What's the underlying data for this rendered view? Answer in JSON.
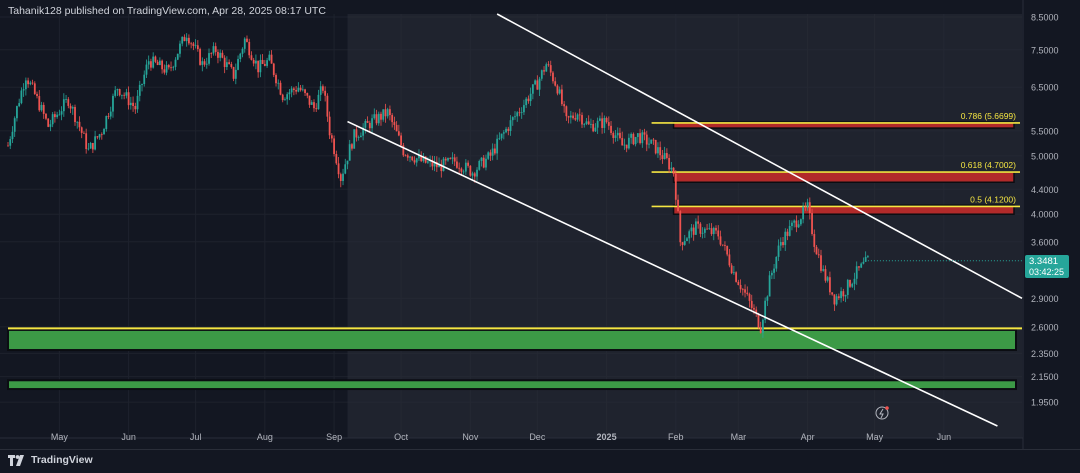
{
  "header": {
    "publisher_line": "Tahanik128 published on TradingView.com, Apr 28, 2025 08:17 UTC"
  },
  "footer": {
    "brand": "TradingView",
    "logo_icon": "tradingview-logo-icon"
  },
  "colors": {
    "background": "#131722",
    "up_candle": "#26a69a",
    "down_candle": "#ef5350",
    "fib_line": "#f5e642",
    "resistance_zone": "#b22a2a",
    "support_zone": "#3c9a46",
    "channel_line": "#ffffff",
    "price_tag": "#26a69a"
  },
  "last_price": {
    "value": "3.3481",
    "countdown": "03:42:25"
  },
  "alert_icon": "replay-alert-icon",
  "chart_data": {
    "type": "candlestick",
    "title": "",
    "y_scale": "log",
    "ylim": [
      1.78,
      8.6
    ],
    "xlim": [
      "2024-04-08",
      "2025-07-06"
    ],
    "y_ticks": [
      "8.5000",
      "7.5000",
      "6.5000",
      "5.5000",
      "5.0000",
      "4.4000",
      "4.0000",
      "3.6000",
      "2.9000",
      "2.6000",
      "2.3500",
      "2.1500",
      "1.9500"
    ],
    "x_tick_labels": [
      {
        "date": "2024-05-01",
        "label": "May"
      },
      {
        "date": "2024-06-01",
        "label": "Jun"
      },
      {
        "date": "2024-07-01",
        "label": "Jul"
      },
      {
        "date": "2024-08-01",
        "label": "Aug"
      },
      {
        "date": "2024-09-01",
        "label": "Sep"
      },
      {
        "date": "2024-10-01",
        "label": "Oct"
      },
      {
        "date": "2024-11-01",
        "label": "Nov"
      },
      {
        "date": "2024-12-01",
        "label": "Dec"
      },
      {
        "date": "2025-01-01",
        "label": "2025"
      },
      {
        "date": "2025-02-01",
        "label": "Feb"
      },
      {
        "date": "2025-03-01",
        "label": "Mar"
      },
      {
        "date": "2025-04-01",
        "label": "Apr"
      },
      {
        "date": "2025-05-01",
        "label": "May"
      },
      {
        "date": "2025-06-01",
        "label": "Jun"
      }
    ],
    "price_path": [
      [
        "2024-04-08",
        5.2
      ],
      [
        "2024-04-16",
        6.8
      ],
      [
        "2024-04-26",
        5.6
      ],
      [
        "2024-05-05",
        6.2
      ],
      [
        "2024-05-14",
        5.1
      ],
      [
        "2024-05-20",
        5.5
      ],
      [
        "2024-05-27",
        6.5
      ],
      [
        "2024-06-04",
        6.0
      ],
      [
        "2024-06-10",
        7.2
      ],
      [
        "2024-06-19",
        6.9
      ],
      [
        "2024-06-27",
        8.0
      ],
      [
        "2024-07-04",
        7.1
      ],
      [
        "2024-07-10",
        7.5
      ],
      [
        "2024-07-18",
        6.8
      ],
      [
        "2024-07-23",
        7.8
      ],
      [
        "2024-07-29",
        7.0
      ],
      [
        "2024-08-03",
        7.2
      ],
      [
        "2024-08-09",
        6.3
      ],
      [
        "2024-08-16",
        6.5
      ],
      [
        "2024-08-23",
        6.0
      ],
      [
        "2024-08-27",
        6.5
      ],
      [
        "2024-08-30",
        5.5
      ],
      [
        "2024-09-04",
        4.6
      ],
      [
        "2024-09-10",
        5.4
      ],
      [
        "2024-09-18",
        5.7
      ],
      [
        "2024-09-25",
        5.9
      ],
      [
        "2024-10-02",
        5.1
      ],
      [
        "2024-10-10",
        4.9
      ],
      [
        "2024-10-18",
        4.8
      ],
      [
        "2024-10-25",
        4.9
      ],
      [
        "2024-11-02",
        4.7
      ],
      [
        "2024-11-10",
        5.0
      ],
      [
        "2024-11-18",
        5.6
      ],
      [
        "2024-11-25",
        6.1
      ],
      [
        "2024-12-01",
        6.6
      ],
      [
        "2024-12-05",
        7.1
      ],
      [
        "2024-12-10",
        6.5
      ],
      [
        "2024-12-14",
        5.7
      ],
      [
        "2024-12-19",
        5.9
      ],
      [
        "2024-12-24",
        5.6
      ],
      [
        "2025-01-01",
        5.7
      ],
      [
        "2025-01-08",
        5.2
      ],
      [
        "2025-01-15",
        5.4
      ],
      [
        "2025-01-22",
        5.2
      ],
      [
        "2025-01-28",
        4.9
      ],
      [
        "2025-01-31",
        4.7
      ],
      [
        "2025-02-03",
        3.6
      ],
      [
        "2025-02-10",
        3.8
      ],
      [
        "2025-02-20",
        3.7
      ],
      [
        "2025-02-27",
        3.2
      ],
      [
        "2025-03-05",
        2.9
      ],
      [
        "2025-03-11",
        2.6
      ],
      [
        "2025-03-15",
        3.1
      ],
      [
        "2025-03-20",
        3.6
      ],
      [
        "2025-03-27",
        3.9
      ],
      [
        "2025-04-01",
        4.1
      ],
      [
        "2025-04-04",
        3.6
      ],
      [
        "2025-04-08",
        3.2
      ],
      [
        "2025-04-13",
        2.9
      ],
      [
        "2025-04-18",
        3.0
      ],
      [
        "2025-04-23",
        3.2
      ],
      [
        "2025-04-28",
        3.35
      ]
    ],
    "fib_levels": [
      {
        "label": "0.786 (5.6699)",
        "ratio": 0.786,
        "price": 5.6699
      },
      {
        "label": "0.618 (4.7002)",
        "ratio": 0.618,
        "price": 4.7002
      },
      {
        "label": "0.5 (4.1200)",
        "ratio": 0.5,
        "price": 4.12
      }
    ],
    "resistance_zones": [
      {
        "from": 5.56,
        "to": 5.69,
        "start": "2025-01-31"
      },
      {
        "from": 4.52,
        "to": 4.7,
        "start": "2025-01-31"
      },
      {
        "from": 4.0,
        "to": 4.14,
        "start": "2025-01-31"
      }
    ],
    "support_zones": [
      {
        "from": 2.38,
        "to": 2.57,
        "start": "2024-04-08"
      },
      {
        "from": 2.05,
        "to": 2.12,
        "start": "2024-04-08"
      }
    ],
    "support_line": {
      "price": 2.585
    },
    "channel": {
      "start": "2024-09-07",
      "upper": [
        [
          "2024-11-13",
          8.6
        ],
        [
          "2025-07-06",
          2.9
        ]
      ],
      "lower": [
        [
          "2024-09-07",
          5.7
        ],
        [
          "2025-06-25",
          1.78
        ]
      ]
    }
  }
}
